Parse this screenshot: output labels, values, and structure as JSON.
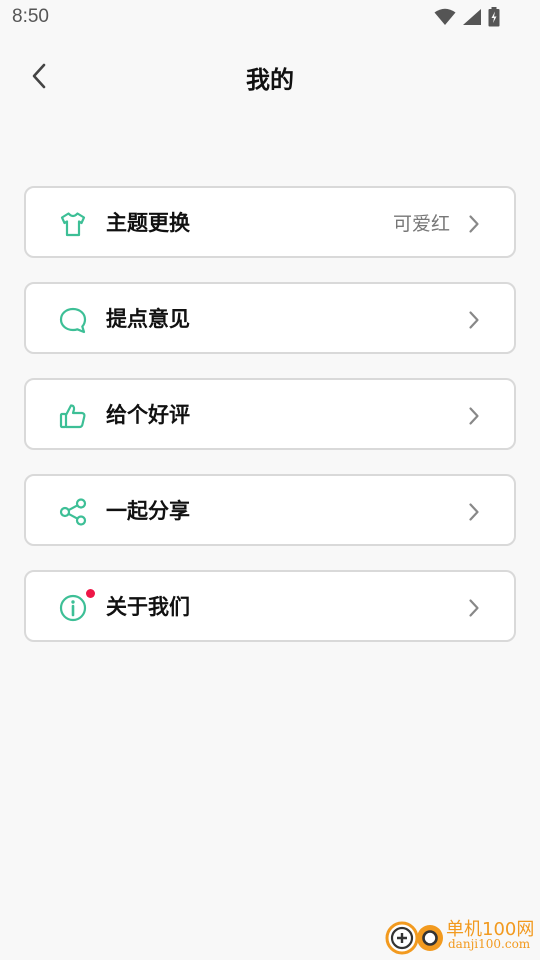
{
  "status_bar": {
    "time": "8:50"
  },
  "header": {
    "title": "我的"
  },
  "menu": {
    "items": [
      {
        "label": "主题更换",
        "value": "可爱红",
        "icon": "tshirt-icon"
      },
      {
        "label": "提点意见",
        "icon": "speech-bubble-icon"
      },
      {
        "label": "给个好评",
        "icon": "thumbs-up-icon"
      },
      {
        "label": "一起分享",
        "icon": "share-icon"
      },
      {
        "label": "关于我们",
        "icon": "info-icon",
        "has_badge": true
      }
    ]
  },
  "watermark": {
    "title": "单机100网",
    "url": "danji100.com"
  },
  "colors": {
    "accent": "#3dbf96",
    "badge": "#ee1747",
    "chevron": "#888888",
    "card_border": "#d9d9d9",
    "background": "#f8f8f8",
    "watermark": "#f29a1f"
  }
}
